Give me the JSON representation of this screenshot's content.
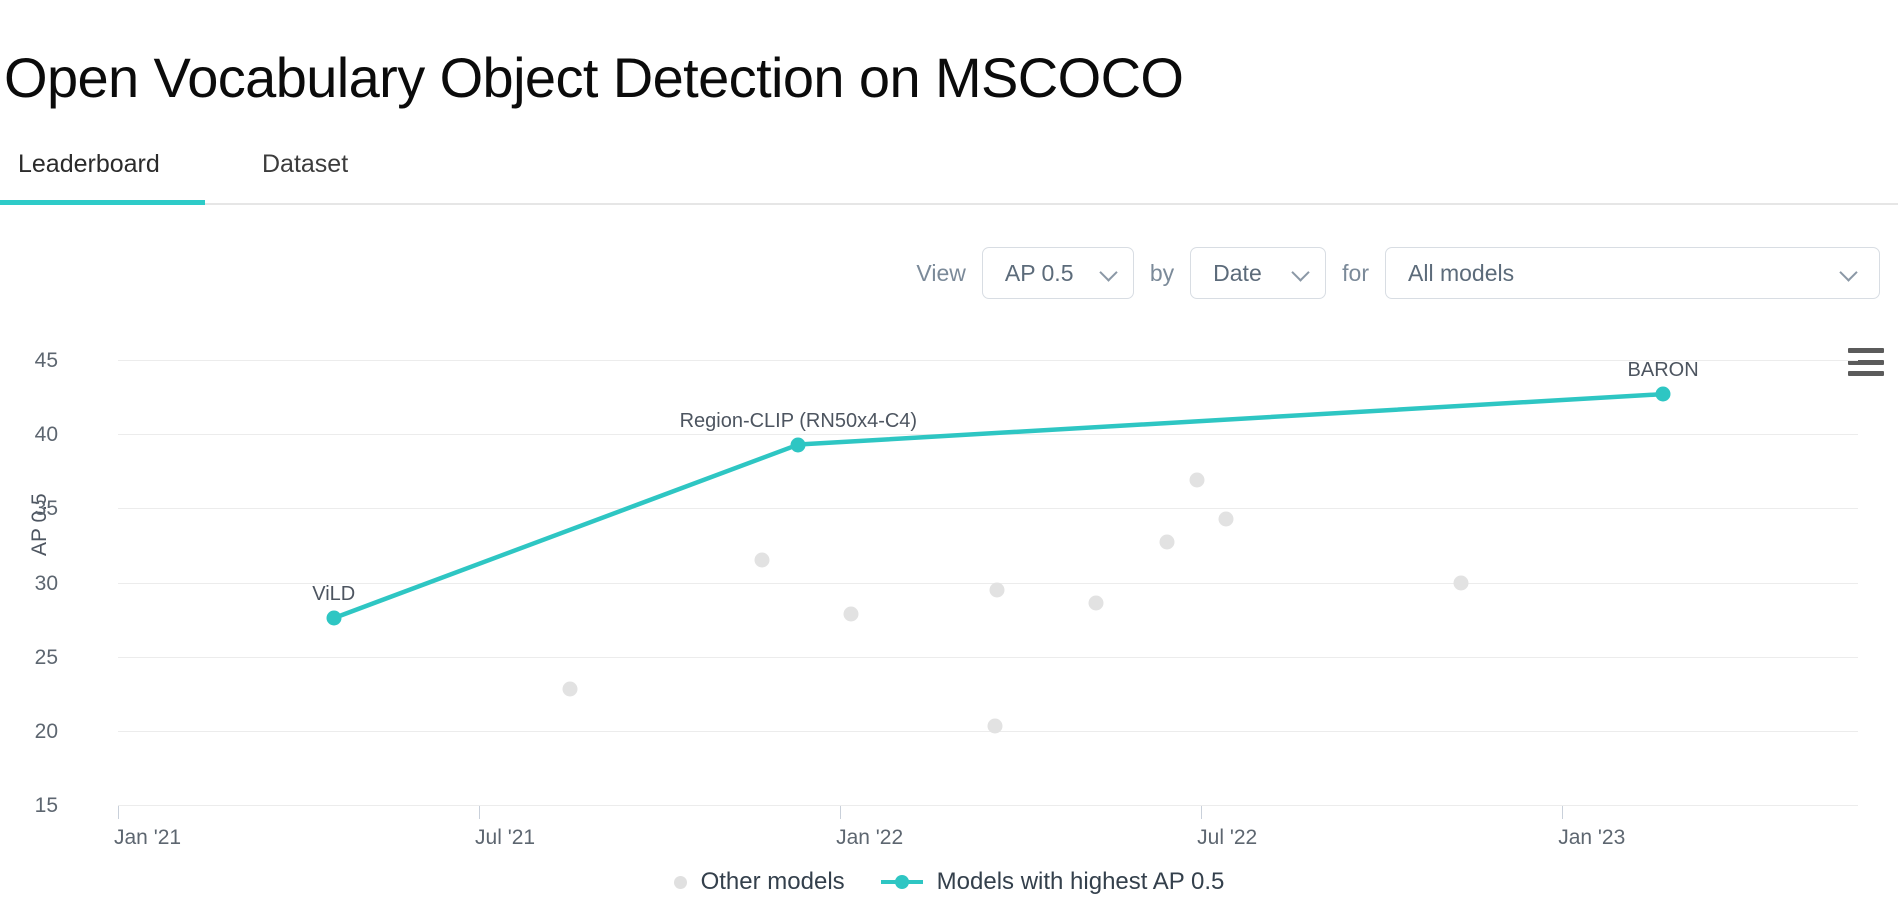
{
  "header": {
    "title": "Open Vocabulary Object Detection on MSCOCO"
  },
  "tabs": [
    {
      "label": "Leaderboard",
      "active": true
    },
    {
      "label": "Dataset",
      "active": false
    }
  ],
  "controls": {
    "view_label": "View",
    "by_label": "by",
    "for_label": "for",
    "metric_select": {
      "value": "AP 0.5",
      "icon": "chevron-down-icon"
    },
    "axis_select": {
      "value": "Date",
      "icon": "chevron-down-icon"
    },
    "models_select": {
      "value": "All models",
      "icon": "chevron-down-icon"
    },
    "menu_icon": "hamburger-menu-icon"
  },
  "colors": {
    "accent": "#2ec6c3",
    "other_point": "#e2e2e2",
    "grid": "#ececec",
    "axis_text": "#5d6670"
  },
  "chart_data": {
    "type": "scatter",
    "title": "Open Vocabulary Object Detection on MSCOCO",
    "xlabel": "",
    "ylabel": "AP 0.5",
    "ylim": [
      15,
      45
    ],
    "yticks": [
      15,
      20,
      25,
      30,
      35,
      40,
      45
    ],
    "xlim": [
      "2021-01",
      "2023-05"
    ],
    "xticks": [
      "Jan '21",
      "Jul '21",
      "Jan '22",
      "Jul '22",
      "Jan '23"
    ],
    "xtick_fractions": [
      0.0,
      0.2075,
      0.415,
      0.6225,
      0.83
    ],
    "grid": true,
    "legend_position": "bottom",
    "series": [
      {
        "name": "Models with highest AP 0.5",
        "type": "line",
        "color": "#2ec6c3",
        "points": [
          {
            "label": "ViLD",
            "date": "May '21",
            "x_frac": 0.124,
            "y": 27.6
          },
          {
            "label": "Region-CLIP (RN50x4-C4)",
            "date": "Dec '21",
            "x_frac": 0.391,
            "y": 39.3
          },
          {
            "label": "BARON",
            "date": "Feb '23",
            "x_frac": 0.888,
            "y": 42.7
          }
        ]
      },
      {
        "name": "Other models",
        "type": "scatter",
        "color": "#e2e2e2",
        "points": [
          {
            "x_frac": 0.26,
            "y": 22.8
          },
          {
            "x_frac": 0.37,
            "y": 31.5
          },
          {
            "x_frac": 0.421,
            "y": 27.9
          },
          {
            "x_frac": 0.505,
            "y": 29.5
          },
          {
            "x_frac": 0.504,
            "y": 20.3
          },
          {
            "x_frac": 0.562,
            "y": 28.6
          },
          {
            "x_frac": 0.603,
            "y": 32.7
          },
          {
            "x_frac": 0.62,
            "y": 36.9
          },
          {
            "x_frac": 0.637,
            "y": 34.3
          },
          {
            "x_frac": 0.772,
            "y": 30.0
          }
        ]
      }
    ],
    "legend": [
      {
        "label": "Other models",
        "marker": "dot",
        "color": "#e2e2e2"
      },
      {
        "label": "Models with highest AP 0.5",
        "marker": "line-dot",
        "color": "#2ec6c3"
      }
    ]
  }
}
